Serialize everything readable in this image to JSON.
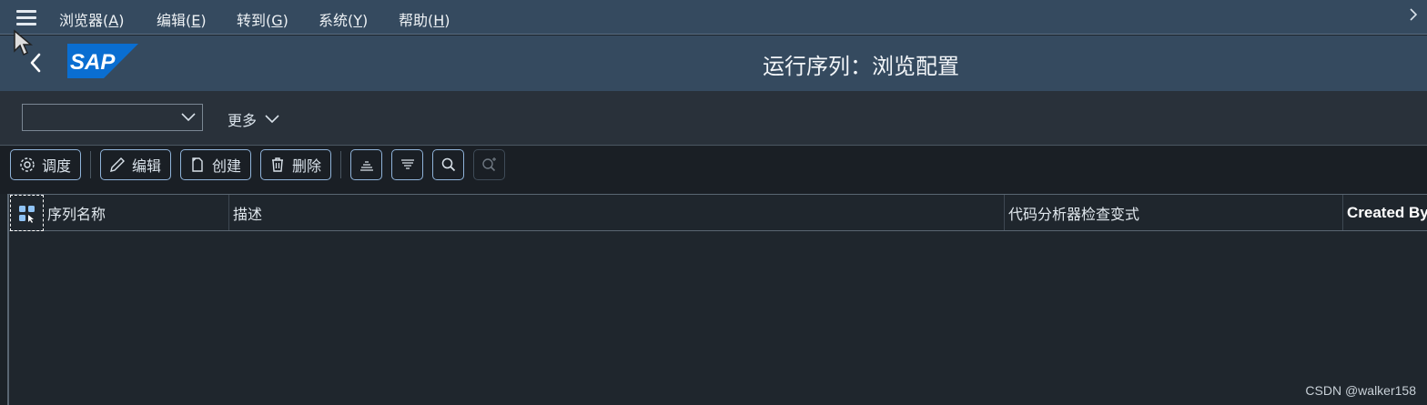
{
  "menubar": {
    "items": [
      {
        "label": "浏览器(",
        "key": "A",
        "end": ")"
      },
      {
        "label": "编辑(",
        "key": "E",
        "end": ")"
      },
      {
        "label": "转到(",
        "key": "G",
        "end": ")"
      },
      {
        "label": "系统(",
        "key": "Y",
        "end": ")"
      },
      {
        "label": "帮助(",
        "key": "H",
        "end": ")"
      }
    ]
  },
  "shell": {
    "logo_text": "SAP",
    "title": "运行序列：浏览配置"
  },
  "subbar": {
    "variant_value": "",
    "more_label": "更多"
  },
  "toolbar": {
    "schedule_label": "调度",
    "edit_label": "编辑",
    "create_label": "创建",
    "delete_label": "删除"
  },
  "table": {
    "columns": [
      "序列名称",
      "描述",
      "代码分析器检查变式",
      "Created By"
    ],
    "rows": []
  },
  "watermark": "CSDN @walker158",
  "colors": {
    "shell_bg": "#354a5f",
    "accent_border": "#8fb3d9",
    "logo_blue": "#0a6ed1"
  }
}
